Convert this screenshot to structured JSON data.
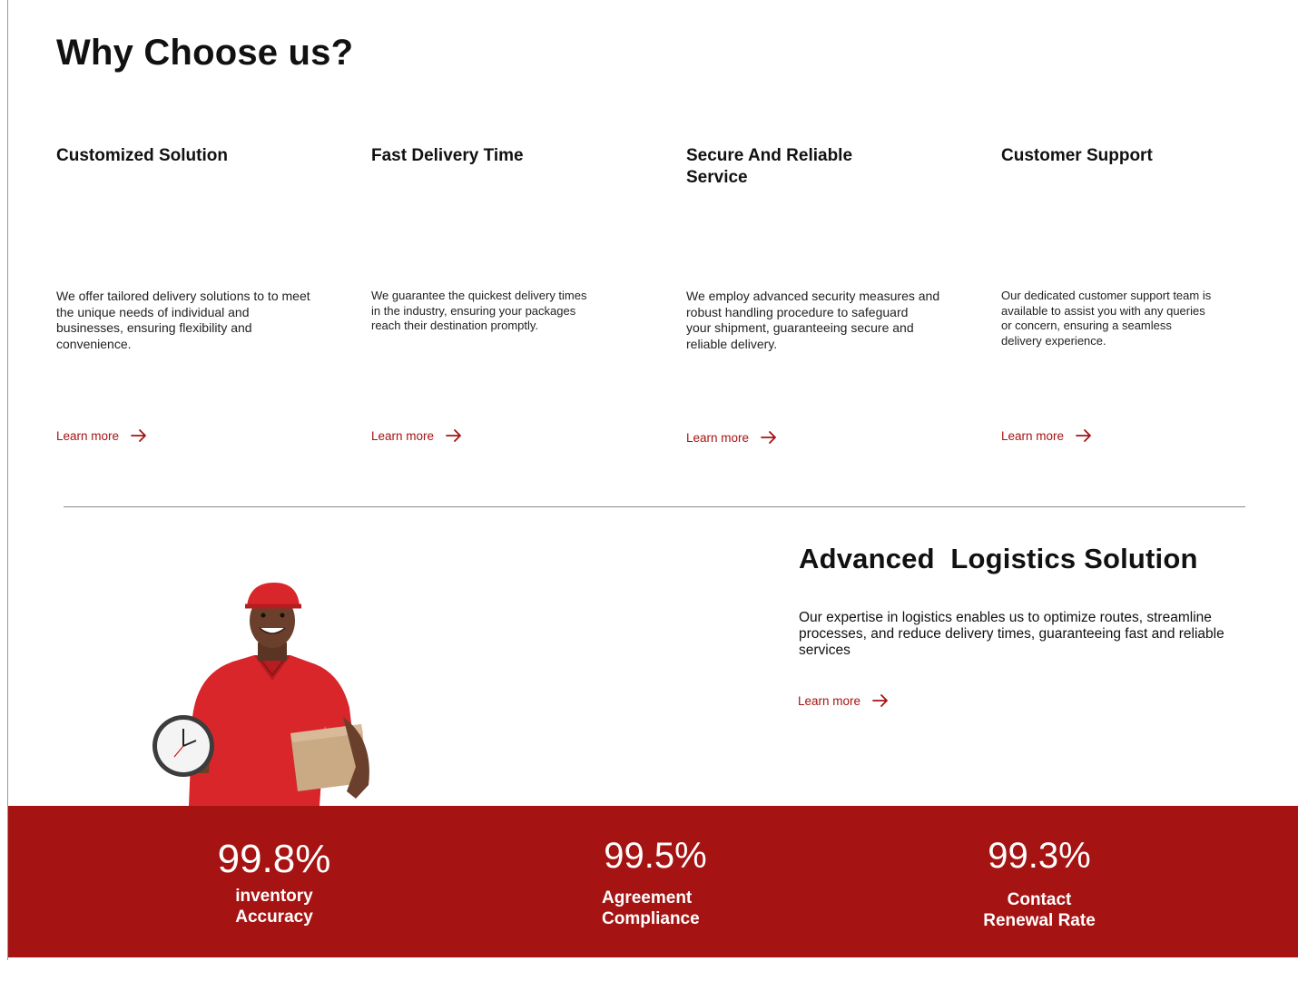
{
  "page_title": "Why Choose us?",
  "features": [
    {
      "title": "Customized Solution",
      "description": "We offer tailored delivery solutions to to meet the unique needs of individual and businesses, ensuring flexibility and convenience.",
      "link": "Learn more"
    },
    {
      "title": "Fast Delivery Time",
      "description": "We guarantee the quickest delivery times in the industry, ensuring your packages reach their destination promptly.",
      "link": "Learn more"
    },
    {
      "title": "Secure And Reliable\nService",
      "description": "We employ advanced security measures and robust handling procedure to safeguard\nyour shipment, guaranteeing secure and reliable delivery.",
      "link": "Learn more"
    },
    {
      "title": "Customer Support",
      "description": "Our dedicated customer support team is available to assist you with any queries or concern, ensuring a seamless delivery experience.",
      "link": "Learn more"
    }
  ],
  "advanced": {
    "title": "Advanced  Logistics Solution",
    "description": "Our expertise in logistics enables us to optimize routes, streamline processes, and reduce delivery times, guaranteeing fast and reliable services",
    "link": "Learn more"
  },
  "stats": [
    {
      "value": "99.8%",
      "label": "inventory\nAccuracy"
    },
    {
      "value": "99.5%",
      "label": "Agreement\nCompliance"
    },
    {
      "value": "99.3%",
      "label": "Contact\nRenewal Rate"
    }
  ],
  "colors": {
    "accent": "#a51312",
    "text": "#111111",
    "background": "#ffffff"
  }
}
